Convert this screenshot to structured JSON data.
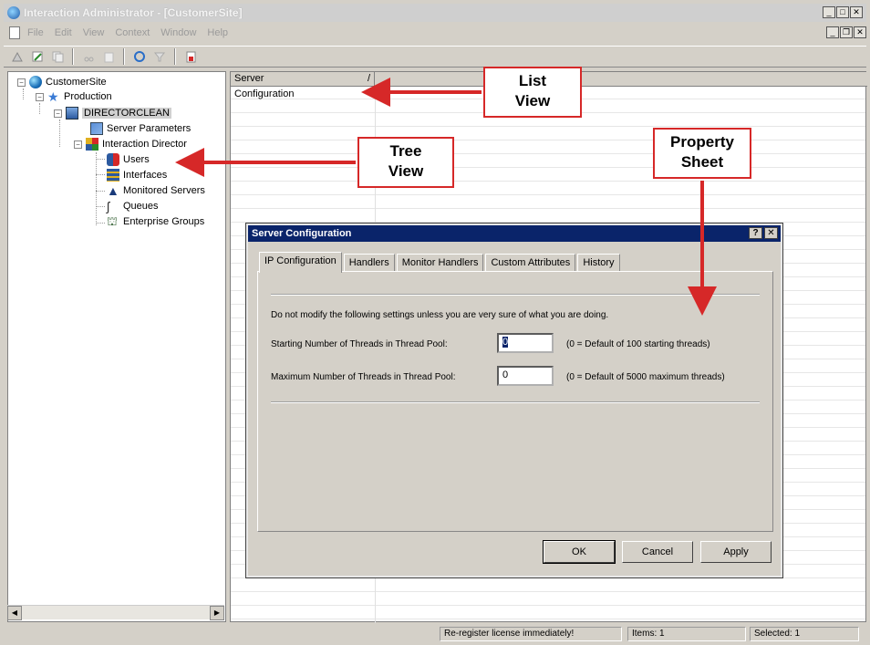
{
  "window": {
    "title": "Interaction Administrator - [CustomerSite]"
  },
  "menu": {
    "items": [
      "File",
      "Edit",
      "View",
      "Context",
      "Window",
      "Help"
    ]
  },
  "tree": {
    "root": "CustomerSite",
    "production": "Production",
    "server": "DIRECTORCLEAN",
    "server_parameters": "Server Parameters",
    "interaction_director": "Interaction Director",
    "users": "Users",
    "interfaces": "Interfaces",
    "monitored_servers": "Monitored Servers",
    "queues": "Queues",
    "enterprise_groups": "Enterprise Groups"
  },
  "list": {
    "header": "Server",
    "sort_indicator": "/",
    "rows": [
      "Configuration"
    ]
  },
  "dialog": {
    "title": "Server Configuration",
    "help_glyph": "?",
    "close_glyph": "✕",
    "tabs": [
      "IP Configuration",
      "Handlers",
      "Monitor Handlers",
      "Custom Attributes",
      "History"
    ],
    "warning": "Do not modify the following settings unless you are very sure of what you are doing.",
    "start_label": "Starting Number of Threads in Thread Pool:",
    "start_value": "0",
    "start_hint": "(0 = Default of 100 starting threads)",
    "max_label": "Maximum Number of Threads in Thread Pool:",
    "max_value": "0",
    "max_hint": "(0 = Default of 5000 maximum threads)",
    "ok": "OK",
    "cancel": "Cancel",
    "apply": "Apply"
  },
  "status": {
    "license": "Re-register license immediately!",
    "items": "Items: 1",
    "selected": "Selected: 1"
  },
  "annotations": {
    "list_view": "List\nView",
    "tree_view": "Tree\nView",
    "property_sheet": "Property\nSheet"
  },
  "colors": {
    "dialog_title": "#0a246a",
    "annotation_red": "#d62828"
  }
}
